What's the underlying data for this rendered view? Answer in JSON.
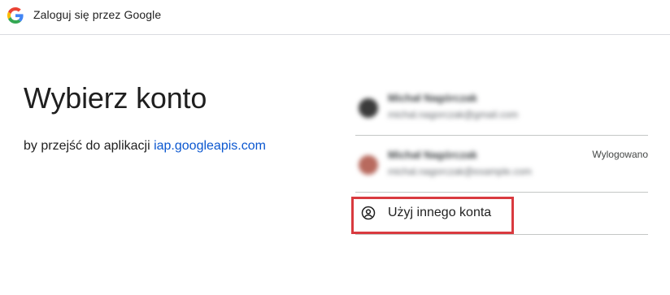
{
  "header": {
    "title": "Zaloguj się przez Google",
    "logo_icon": "google-g-icon"
  },
  "main": {
    "title": "Wybierz konto",
    "subtitle_prefix": "by przejść do aplikacji ",
    "subtitle_link": "iap.googleapis.com"
  },
  "accounts": [
    {
      "name": "Michał Nagórczak",
      "email": "michal.nagorczak@gmail.com",
      "status": "",
      "avatar_color": "#3a3a3a"
    },
    {
      "name": "Michał Nagórczak",
      "email": "michal.nagorczak@example.com",
      "status": "Wylogowano",
      "avatar_color": "#b86a5e"
    }
  ],
  "use_other": {
    "label": "Użyj innego konta",
    "icon": "account-circle-icon"
  },
  "colors": {
    "link": "#0b57d0",
    "highlight": "#d93a3f",
    "divider": "#c4c7c5"
  }
}
